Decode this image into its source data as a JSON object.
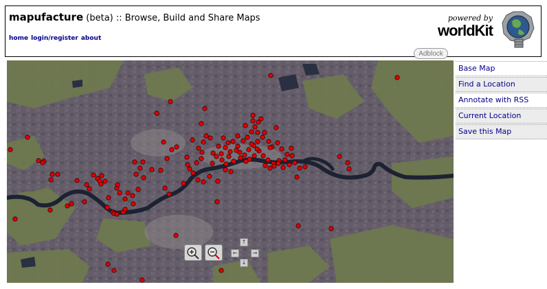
{
  "header": {
    "brand": "mapufacture",
    "beta": " (beta)",
    "tagline": " :: Browse, Build and Share Maps",
    "nav": [
      "home",
      "login/register",
      "about"
    ],
    "powered_by": "powered by",
    "powered_logo": "worldKit"
  },
  "adblock": "Adblock",
  "sidebar": {
    "items": [
      {
        "label": "Base Map",
        "shaded": false
      },
      {
        "label": "Find a Location",
        "shaded": true
      },
      {
        "label": "Annotate with RSS",
        "shaded": false
      },
      {
        "label": "Current Location",
        "shaded": true
      },
      {
        "label": "Save this Map",
        "shaded": true
      }
    ]
  },
  "map": {
    "marker_color": "#e00000",
    "river_color": "#1d2233",
    "controls": {
      "zoom_in": "zoom-in-icon",
      "zoom_out": "zoom-out-icon",
      "pan_up": "↑",
      "pan_down": "↓",
      "pan_left": "←",
      "pan_right": "→"
    }
  }
}
